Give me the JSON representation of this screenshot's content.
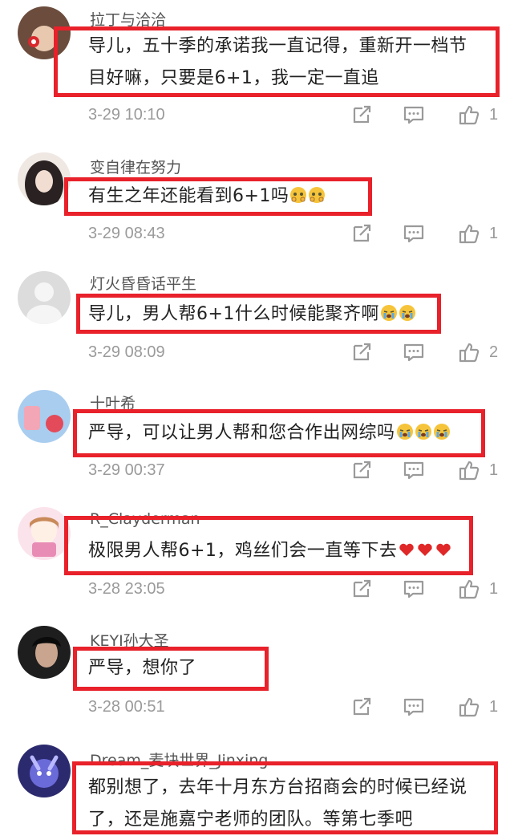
{
  "comments": [
    {
      "username": "拉丁与洽洽",
      "text_lines": [
        "导儿，五十季的承诺我一直记得，重新开一档节",
        "目好嘛，只要是6+1，我一定一直追"
      ],
      "time": "3-29 10:10",
      "likes": "1",
      "emoji": "",
      "avatar_color": "#7a5a4a"
    },
    {
      "username": "变自律在努力",
      "text_lines": [
        "有生之年还能看到6+1吗"
      ],
      "time": "3-29 08:43",
      "likes": "1",
      "emoji": "shy",
      "avatar_color": "#3a3030"
    },
    {
      "username": "灯火昏昏话平生",
      "text_lines": [
        "导儿，男人帮6+1什么时候能聚齐啊"
      ],
      "time": "3-29 08:09",
      "likes": "2",
      "emoji": "crying",
      "avatar_color": "#d8d8d8"
    },
    {
      "username": "十叶希",
      "text_lines": [
        "严导，可以让男人帮和您合作出网综吗"
      ],
      "time": "3-29 00:37",
      "likes": "1",
      "emoji": "crying3",
      "avatar_color": "#9fc3e6"
    },
    {
      "username": "R_Clayderman",
      "text_lines": [
        "极限男人帮6+1，鸡丝们会一直等下去"
      ],
      "time": "3-28 23:05",
      "likes": "1",
      "emoji": "hearts",
      "avatar_color": "#f3c6d6"
    },
    {
      "username": "KEYI孙大圣",
      "text_lines": [
        "严导，想你了"
      ],
      "time": "3-28 00:51",
      "likes": "1",
      "emoji": "",
      "avatar_color": "#2b2b2b"
    },
    {
      "username": "Dream_麦块世界_Jinxing",
      "text_lines": [
        "都别想了，去年十月东方台招商会的时候已经说",
        "了，还是施嘉宁老师的团队。等第七季吧"
      ],
      "time": "",
      "likes": "",
      "emoji": "",
      "avatar_color": "#3d3a8a"
    }
  ],
  "icons": {
    "share": "share-icon",
    "reply": "reply-icon",
    "like": "thumbs-up-icon"
  },
  "colors": {
    "highlight_box": "#e8212a",
    "meta_text": "#9a9a9a",
    "icon": "#9a9a9a"
  }
}
